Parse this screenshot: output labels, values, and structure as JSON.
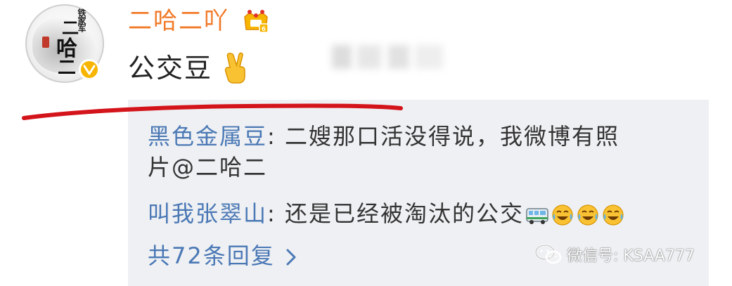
{
  "post": {
    "username": "二哈二吖",
    "text": "公交豆",
    "avatar": {
      "chars": [
        "铁家军",
        "二",
        "哈",
        "二"
      ]
    }
  },
  "comments": [
    {
      "user": "黑色金属豆",
      "separator": ": ",
      "text_line1": "二嫂那口活没得说，我微博有照",
      "text_line2": "片@二哈二"
    },
    {
      "user": "叫我张翠山",
      "separator": ": ",
      "text": "还是已经被淘汰的公交"
    }
  ],
  "replies": {
    "label": "共72条回复"
  },
  "watermark": {
    "text": "微信号: KSAA777"
  },
  "icons": {
    "vip": "vip-crown-icon",
    "verified": "verified-v-icon",
    "victory": "victory-hand-icon",
    "bus": "bus-emoji-icon",
    "laugh_cry": "laugh-cry-emoji-icon",
    "chevron": "chevron-right-icon",
    "wechat": "wechat-icon"
  },
  "colors": {
    "username": "#f27a2a",
    "comment_user": "#4a78b5",
    "comment_bg": "#eef0f3",
    "annotation_red": "#d4141b"
  }
}
